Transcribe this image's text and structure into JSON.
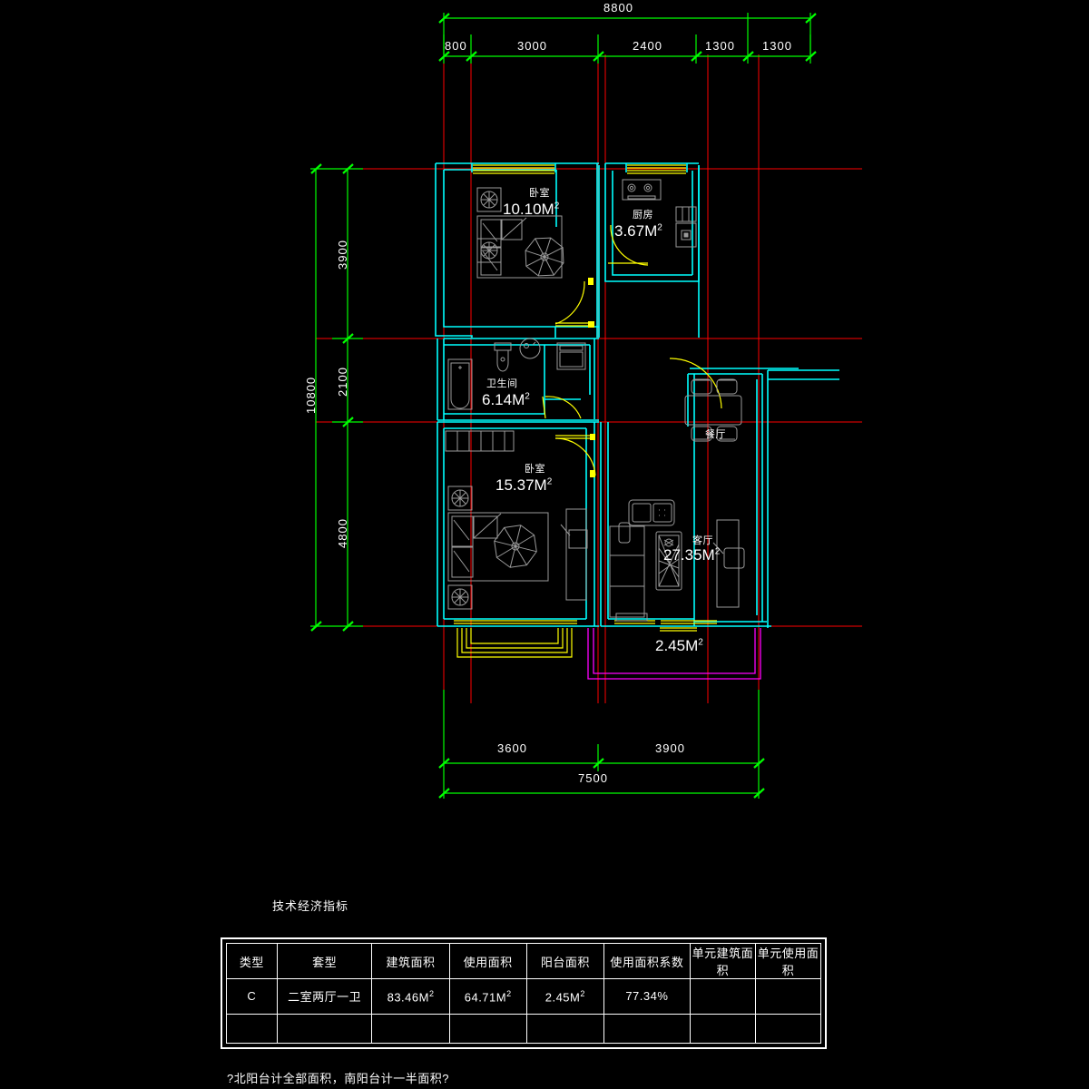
{
  "drawing": {
    "type": "cad-floor-plan",
    "background_color": "#000000",
    "colors": {
      "walls": "#00ffff",
      "axis_grid": "#ff0000",
      "dimension": "#00ff00",
      "furniture": "#9a9a9a",
      "doors_windows": "#ffff00",
      "balcony_north": "#ff00ff",
      "text": "#ffffff"
    }
  },
  "rooms": [
    {
      "id": "bedroom-north",
      "name": "卧室",
      "area": "10.10M",
      "area_sup": "2"
    },
    {
      "id": "kitchen",
      "name": "厨房",
      "area": "3.67M",
      "area_sup": "2"
    },
    {
      "id": "bathroom",
      "name": "卫生间",
      "area": "6.14M",
      "area_sup": "2"
    },
    {
      "id": "bedroom-south",
      "name": "卧室",
      "area": "15.37M",
      "area_sup": "2"
    },
    {
      "id": "dining",
      "name": "餐厅",
      "area": "",
      "area_sup": ""
    },
    {
      "id": "living",
      "name": "客厅",
      "area": "27.35M",
      "area_sup": "2"
    },
    {
      "id": "balcony-north",
      "name": "",
      "area": "2.45M",
      "area_sup": "2"
    }
  ],
  "dimensions": {
    "top": {
      "total": "8800",
      "segments": [
        "800",
        "3000",
        "2400",
        "1300",
        "1300"
      ]
    },
    "left": {
      "total": "10800",
      "segments": [
        "3900",
        "2100",
        "4800"
      ]
    },
    "bottom": {
      "total": "7500",
      "segments": [
        "3600",
        "3900"
      ]
    }
  },
  "table": {
    "title": "技术经济指标",
    "headers": [
      "类型",
      "套型",
      "建筑面积",
      "使用面积",
      "阳台面积",
      "使用面积系数",
      "单元建筑面积",
      "单元使用面积"
    ],
    "rows": [
      {
        "type": "C",
        "layout": "二室两厅一卫",
        "building_area": "83.46M",
        "building_area_sup": "2",
        "usable_area": "64.71M",
        "usable_area_sup": "2",
        "balcony_area": "2.45M",
        "balcony_area_sup": "2",
        "usable_ratio": "77.34%",
        "unit_building_area": "",
        "unit_usable_area": ""
      },
      {
        "type": "",
        "layout": "",
        "building_area": "",
        "building_area_sup": "",
        "usable_area": "",
        "usable_area_sup": "",
        "balcony_area": "",
        "balcony_area_sup": "",
        "usable_ratio": "",
        "unit_building_area": "",
        "unit_usable_area": ""
      }
    ]
  },
  "note": "?北阳台计全部面积，南阳台计一半面积?"
}
